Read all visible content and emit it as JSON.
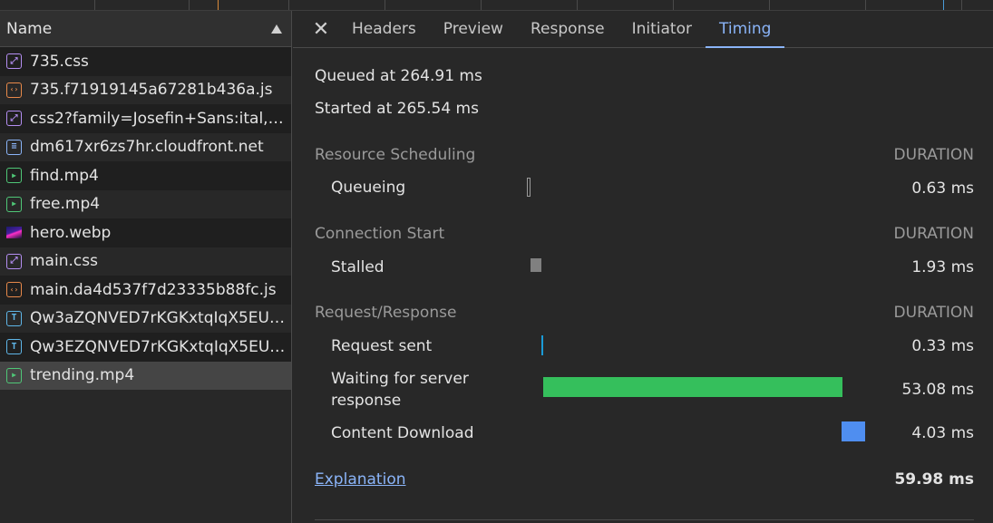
{
  "request_list": {
    "header": "Name",
    "rows": [
      {
        "name": "735.css",
        "type": "css"
      },
      {
        "name": "735.f71919145a67281b436a.js",
        "type": "js"
      },
      {
        "name": "css2?family=Josefin+Sans:ital,wg...",
        "type": "css"
      },
      {
        "name": "dm617xr6zs7hr.cloudfront.net",
        "type": "doc"
      },
      {
        "name": "find.mp4",
        "type": "media"
      },
      {
        "name": "free.mp4",
        "type": "media"
      },
      {
        "name": "hero.webp",
        "type": "img"
      },
      {
        "name": "main.css",
        "type": "css"
      },
      {
        "name": "main.da4d537f7d23335b88fc.js",
        "type": "js"
      },
      {
        "name": "Qw3aZQNVED7rKGKxtqIqX5EUD...",
        "type": "font"
      },
      {
        "name": "Qw3EZQNVED7rKGKxtqIqX5EUC...",
        "type": "font"
      },
      {
        "name": "trending.mp4",
        "type": "media"
      }
    ],
    "selected_index": 11
  },
  "tabs": [
    "Headers",
    "Preview",
    "Response",
    "Initiator",
    "Timing"
  ],
  "active_tab": "Timing",
  "timing": {
    "queued": "Queued at 264.91 ms",
    "started": "Started at 265.54 ms",
    "duration_header": "DURATION",
    "sections": [
      {
        "title": "Resource Scheduling",
        "phases": [
          {
            "label": "Queueing",
            "value": "0.63 ms"
          }
        ]
      },
      {
        "title": "Connection Start",
        "phases": [
          {
            "label": "Stalled",
            "value": "1.93 ms"
          }
        ]
      },
      {
        "title": "Request/Response",
        "phases": [
          {
            "label": "Request sent",
            "value": "0.33 ms"
          },
          {
            "label": "Waiting for server response",
            "value": "53.08 ms"
          },
          {
            "label": "Content Download",
            "value": "4.03 ms"
          }
        ]
      }
    ],
    "explanation": "Explanation",
    "total": "59.98 ms"
  },
  "colors": {
    "queueing": "#9a9a9a",
    "stalled": "#808080",
    "request_sent": "#1a9bd7",
    "waiting": "#35bf5c",
    "download": "#4f8ef0",
    "accent": "#8ab4f8"
  }
}
